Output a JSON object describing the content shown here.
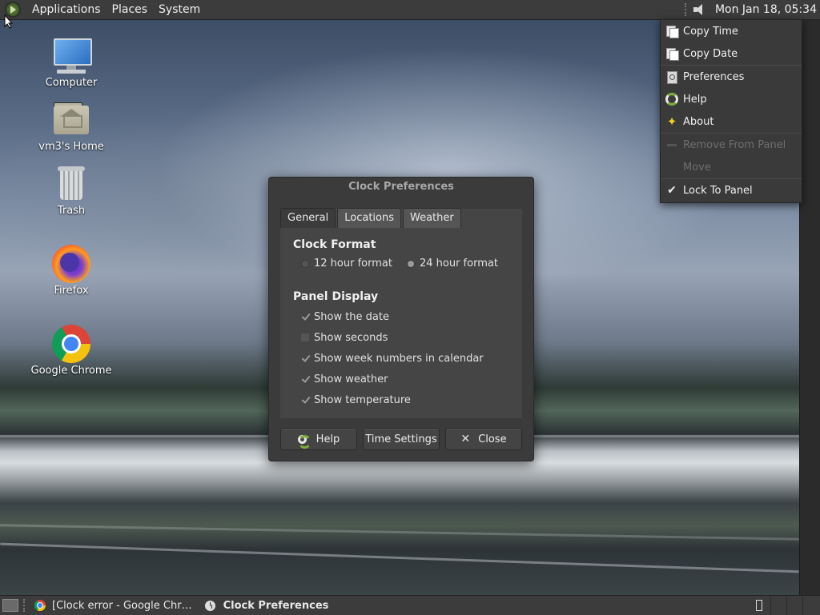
{
  "top_panel": {
    "menus": [
      "Applications",
      "Places",
      "System"
    ],
    "clock": "Mon Jan 18, 05:34"
  },
  "desktop_icons": [
    {
      "label": "Computer",
      "icon": "computer-icon"
    },
    {
      "label": "vm3's Home",
      "icon": "home-folder-icon"
    },
    {
      "label": "Trash",
      "icon": "trash-icon"
    },
    {
      "label": "Firefox",
      "icon": "firefox-icon"
    },
    {
      "label": "Google Chrome",
      "icon": "chrome-icon"
    }
  ],
  "dialog": {
    "title": "Clock Preferences",
    "tabs": [
      "General",
      "Locations",
      "Weather"
    ],
    "active_tab": "General",
    "clock_format": {
      "heading": "Clock Format",
      "options": [
        "12 hour format",
        "24 hour format"
      ],
      "selected": "24 hour format"
    },
    "panel_display": {
      "heading": "Panel Display",
      "options": [
        {
          "label": "Show the date",
          "checked": true
        },
        {
          "label": "Show seconds",
          "checked": false
        },
        {
          "label": "Show week numbers in calendar",
          "checked": true
        },
        {
          "label": "Show weather",
          "checked": true
        },
        {
          "label": "Show temperature",
          "checked": true
        }
      ]
    },
    "buttons": {
      "help": "Help",
      "time_settings": "Time Settings",
      "close": "Close"
    }
  },
  "context_menu": {
    "items": [
      {
        "label": "Copy Time",
        "icon": "copy-icon",
        "enabled": true
      },
      {
        "label": "Copy Date",
        "icon": "copy-icon",
        "enabled": true
      },
      {
        "label": "Preferences",
        "icon": "preferences-icon",
        "enabled": true
      },
      {
        "label": "Help",
        "icon": "help-icon",
        "enabled": true
      },
      {
        "label": "About",
        "icon": "about-icon",
        "enabled": true
      },
      {
        "label": "Remove From Panel",
        "icon": "remove-icon",
        "enabled": false
      },
      {
        "label": "Move",
        "icon": "",
        "enabled": false
      },
      {
        "label": "Lock To Panel",
        "icon": "check-icon",
        "enabled": true,
        "checked": true
      }
    ]
  },
  "taskbar": {
    "tasks": [
      {
        "label": "[Clock error - Google Chr…",
        "icon": "chrome-icon",
        "active": false
      },
      {
        "label": "Clock Preferences",
        "icon": "clock-icon",
        "active": true
      }
    ]
  }
}
